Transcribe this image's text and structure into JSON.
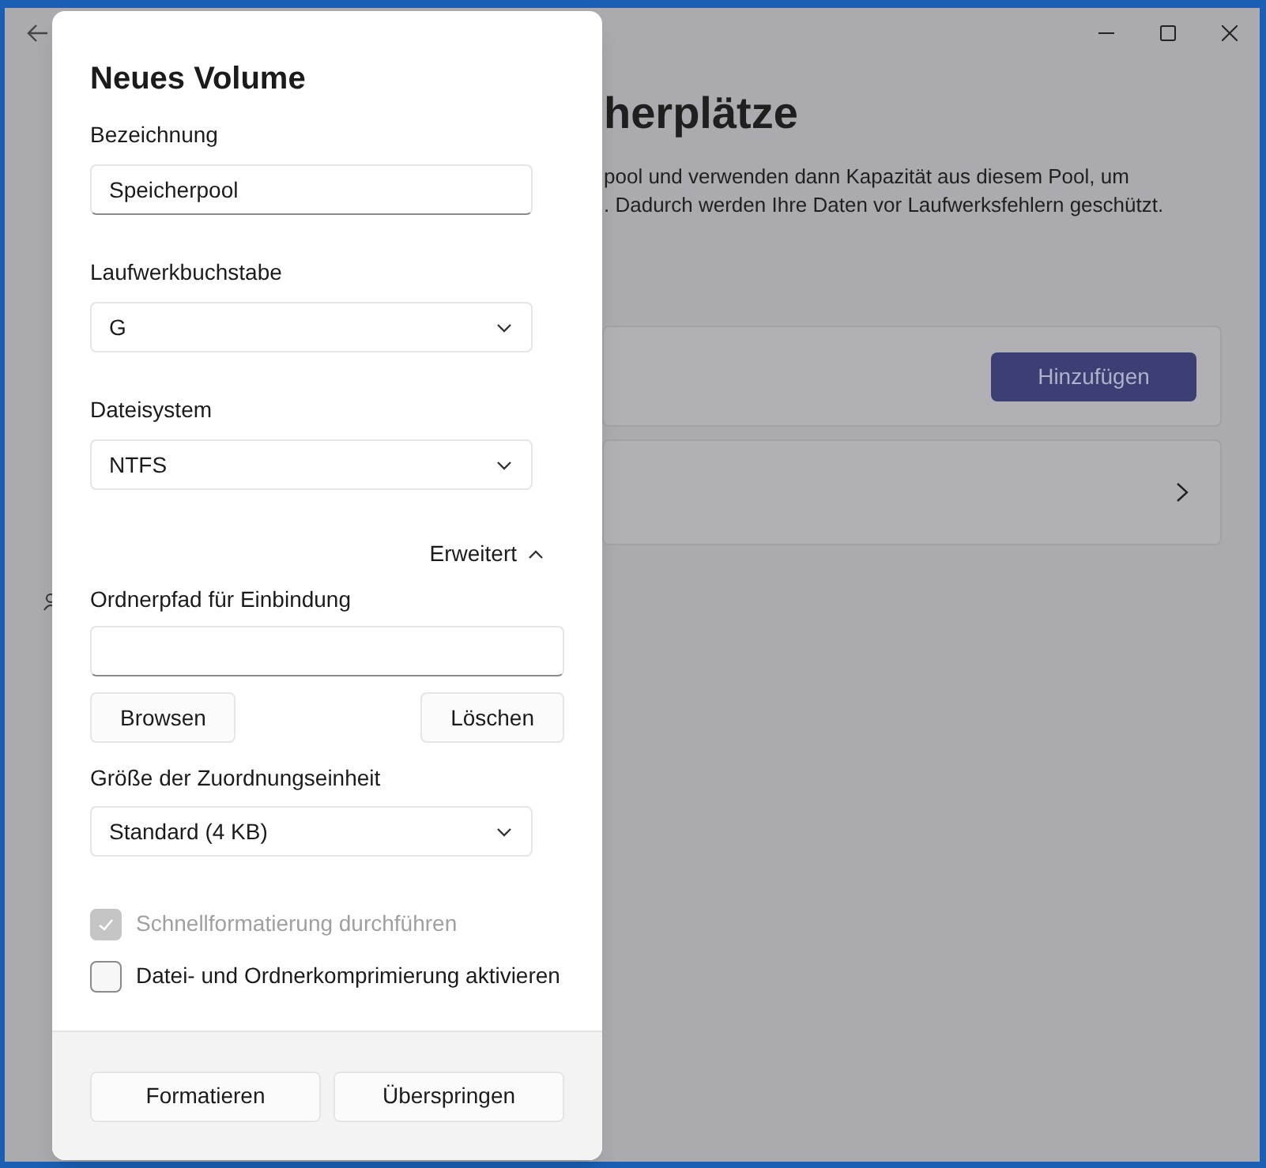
{
  "background_window": {
    "title_fragment": "herplätze",
    "description_lines": [
      "pool und verwenden dann Kapazität aus diesem Pool, um",
      ". Dadurch werden Ihre Daten vor Laufwerksfehlern geschützt."
    ],
    "add_button": "Hinzufügen"
  },
  "dialog": {
    "title": "Neues Volume",
    "fields": [
      {
        "kind": "text",
        "label": "Bezeichnung",
        "value": "Speicherpool"
      },
      {
        "kind": "dropdown",
        "label": "Laufwerkbuchstabe",
        "value": "G"
      },
      {
        "kind": "dropdown",
        "label": "Dateisystem",
        "value": "NTFS"
      }
    ],
    "advanced": {
      "label": "Erweitert",
      "expanded": true
    },
    "mount_path": {
      "label": "Ordnerpfad für Einbindung",
      "buttons": [
        "Browsen",
        "Löschen"
      ]
    },
    "allocation_unit": {
      "label": "Größe der Zuordnungseinheit",
      "value": "Standard (4 KB)"
    },
    "options": [
      {
        "label": "Schnellformatierung durchführen",
        "checked": true,
        "disabled": true
      },
      {
        "label": "Datei- und Ordnerkomprimierung aktivieren",
        "checked": false,
        "disabled": false
      }
    ],
    "footer_buttons": [
      "Formatieren",
      "Überspringen"
    ]
  }
}
